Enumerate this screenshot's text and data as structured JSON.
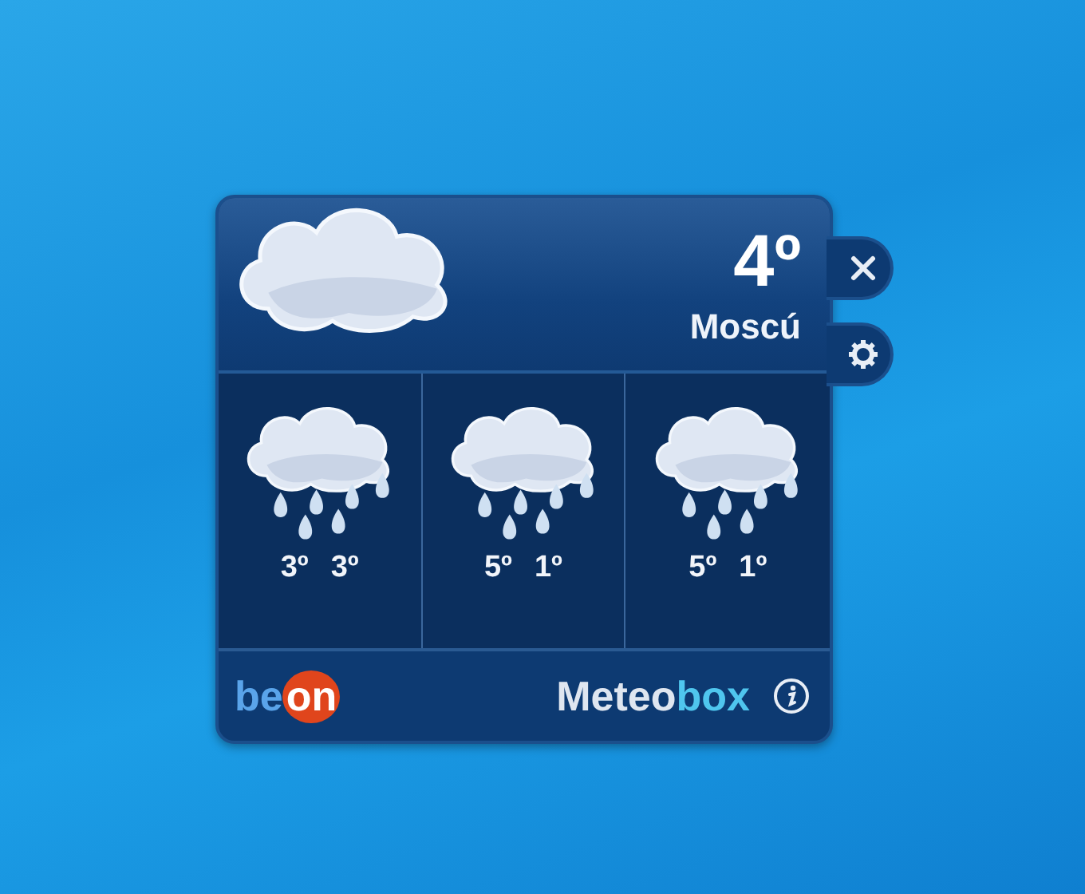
{
  "current": {
    "kind": "cloudy",
    "temperature": "4º",
    "city": "Moscú"
  },
  "forecast": [
    {
      "kind": "rain",
      "high": "3º",
      "low": "3º"
    },
    {
      "kind": "rain",
      "high": "5º",
      "low": "1º"
    },
    {
      "kind": "rain",
      "high": "5º",
      "low": "1º"
    }
  ],
  "footer": {
    "brand_logo": {
      "part_1": "be",
      "part_2": "on"
    },
    "product_name": {
      "part_1": "Meteo",
      "part_2": "box"
    }
  }
}
